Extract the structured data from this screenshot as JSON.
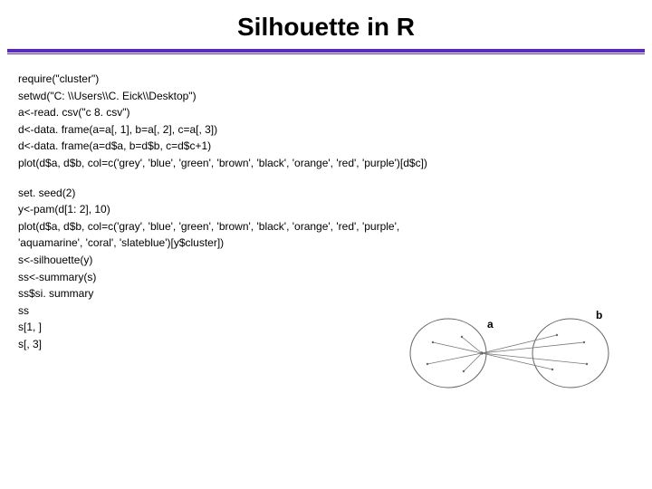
{
  "title": "Silhouette in R",
  "code_block_1": [
    "require(\"cluster\")",
    "setwd(\"C: \\\\Users\\\\C. Eick\\\\Desktop\")",
    "a<-read. csv(\"c 8. csv\")",
    "d<-data. frame(a=a[, 1], b=a[, 2], c=a[, 3])",
    "d<-data. frame(a=d$a, b=d$b, c=d$c+1)",
    "plot(d$a, d$b, col=c('grey', 'blue', 'green', 'brown', 'black', 'orange', 'red', 'purple')[d$c])"
  ],
  "code_block_2": [
    "set. seed(2)",
    "y<-pam(d[1: 2], 10)",
    "plot(d$a, d$b, col=c('gray', 'blue', 'green', 'brown', 'black', 'orange', 'red', 'purple',",
    "'aquamarine', 'coral', 'slateblue')[y$cluster])",
    "s<-silhouette(y)",
    "ss<-summary(s)",
    "ss$si. summary",
    "ss",
    "s[1, ]",
    "s[, 3]"
  ],
  "diagram": {
    "label_a": "a",
    "label_b": "b"
  }
}
